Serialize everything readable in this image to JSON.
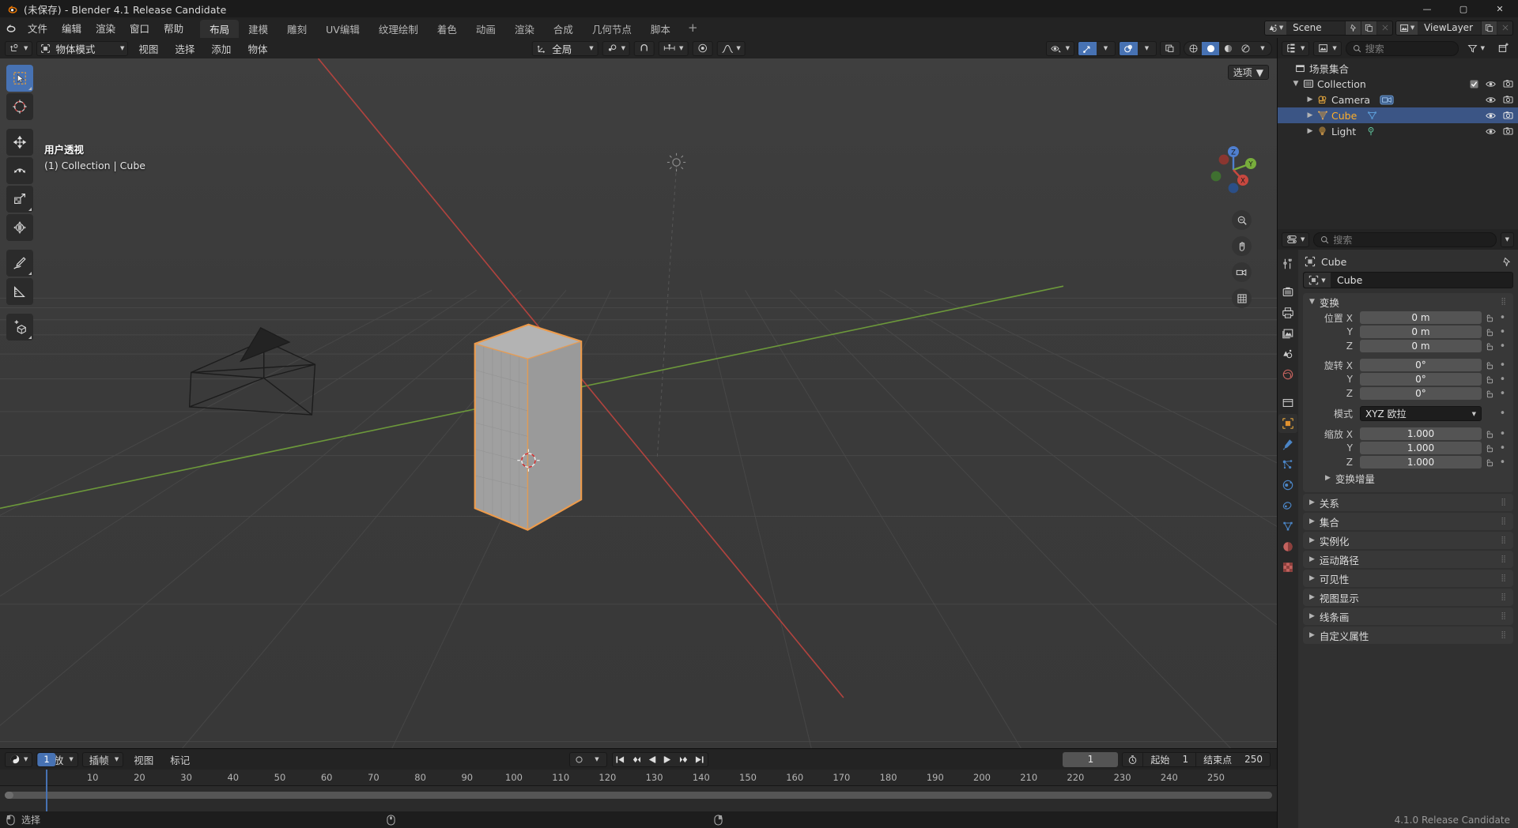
{
  "window": {
    "title": "(未保存) - Blender 4.1 Release Candidate",
    "minimize": "—",
    "maximize": "▢",
    "close": "✕"
  },
  "topbar": {
    "menus": [
      "文件",
      "编辑",
      "渲染",
      "窗口",
      "帮助"
    ],
    "workspaces": [
      "布局",
      "建模",
      "雕刻",
      "UV编辑",
      "纹理绘制",
      "着色",
      "动画",
      "渲染",
      "合成",
      "几何节点",
      "脚本"
    ],
    "active_workspace": "布局",
    "add_workspace": "+",
    "scene_name": "Scene",
    "viewlayer_name": "ViewLayer"
  },
  "viewport_header": {
    "mode": "物体模式",
    "menus": [
      "视图",
      "选择",
      "添加",
      "物体"
    ],
    "transform_orientation": "全局",
    "options_label": "选项"
  },
  "viewport": {
    "perspective_label": "用户透视",
    "context_label": "(1) Collection | Cube",
    "gizmo_axes": [
      "Z",
      "Y",
      "X"
    ]
  },
  "outliner": {
    "search_placeholder": "搜索",
    "scene_collection": "场景集合",
    "items": [
      {
        "label": "Collection",
        "type": "collection",
        "depth": 0,
        "selected": false,
        "expanded": true
      },
      {
        "label": "Camera",
        "type": "camera",
        "depth": 1,
        "selected": false,
        "expanded": false
      },
      {
        "label": "Cube",
        "type": "mesh",
        "depth": 1,
        "selected": true,
        "expanded": false
      },
      {
        "label": "Light",
        "type": "light",
        "depth": 1,
        "selected": false,
        "expanded": false
      }
    ]
  },
  "properties": {
    "search_placeholder": "搜索",
    "breadcrumb_object": "Cube",
    "id_name": "Cube",
    "transform": {
      "title": "变换",
      "location_label": "位置",
      "rotation_label": "旋转",
      "scale_label": "缩放",
      "mode_label": "模式",
      "mode_value": "XYZ 欧拉",
      "axes": [
        "X",
        "Y",
        "Z"
      ],
      "location": [
        "0 m",
        "0 m",
        "0 m"
      ],
      "rotation": [
        "0°",
        "0°",
        "0°"
      ],
      "scale": [
        "1.000",
        "1.000",
        "1.000"
      ],
      "delta_label": "变换增量"
    },
    "collapsed_panels": [
      "关系",
      "集合",
      "实例化",
      "运动路径",
      "可见性",
      "视图显示",
      "线条画",
      "自定义属性"
    ]
  },
  "timeline": {
    "editor_menus": [
      "回放",
      "插帧",
      "视图",
      "标记"
    ],
    "current_frame": "1",
    "start_label": "起始",
    "start_value": "1",
    "end_label": "结束点",
    "end_value": "250",
    "ticks": [
      "10",
      "20",
      "30",
      "40",
      "50",
      "60",
      "70",
      "80",
      "90",
      "100",
      "110",
      "120",
      "130",
      "140",
      "150",
      "160",
      "170",
      "180",
      "190",
      "200",
      "210",
      "220",
      "230",
      "240",
      "250"
    ],
    "playhead_frame": "1"
  },
  "status": {
    "select_label": "选择",
    "version": "4.1.0 Release Candidate"
  },
  "colors": {
    "accent_blue": "#4772b3",
    "selected_orange": "#ffaf29",
    "header_bg": "#232323",
    "editor_bg": "#303030",
    "viewport_bg": "#3b3b3b",
    "axis_x": "#cf4a4a",
    "axis_y": "#7aaf3b"
  }
}
